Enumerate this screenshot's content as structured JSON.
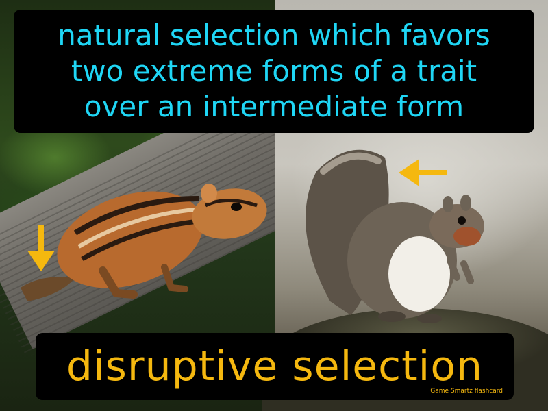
{
  "definition": {
    "line1": "natural selection which favors",
    "line2": "two extreme forms of a trait",
    "line3": "over an intermediate form"
  },
  "term": "disruptive selection",
  "credit": "Game Smartz  flashcard",
  "colors": {
    "definition_text": "#1fd6f5",
    "term_text": "#f5b80f",
    "arrow": "#f5b80f",
    "box_background": "#000000"
  },
  "icons": {
    "left_arrow": "arrow-down-icon",
    "right_arrow": "arrow-left-icon"
  }
}
